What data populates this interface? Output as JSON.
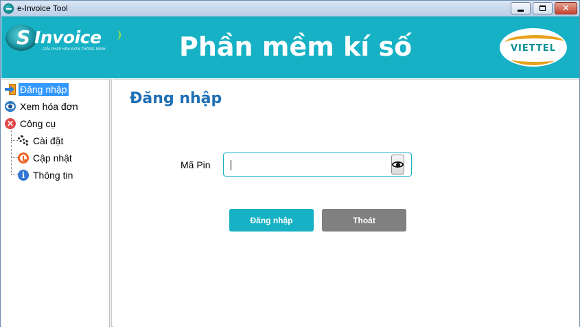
{
  "window": {
    "title": "e-Invoice Tool",
    "controls": {
      "minimize": "minimize",
      "maximize": "maximize",
      "close": "✕"
    }
  },
  "header": {
    "logo_left": {
      "brand_letter": "S",
      "brand_word": "Invoice",
      "tagline": "GIẢI PHÁP HÓA ĐƠN THÔNG MINH"
    },
    "title": "Phần mềm kí số",
    "logo_right": {
      "text": "VIETTEL"
    },
    "background_color": "#17b1c5"
  },
  "sidebar": {
    "items": [
      {
        "label": "Đăng nhập",
        "icon": "login-icon",
        "selected": true
      },
      {
        "label": "Xem hóa đơn",
        "icon": "eye-icon",
        "selected": false
      },
      {
        "label": "Công cụ",
        "icon": "tools-icon",
        "selected": false,
        "children": [
          {
            "label": "Cài đặt",
            "icon": "gears-icon"
          },
          {
            "label": "Cập nhật",
            "icon": "update-icon"
          },
          {
            "label": "Thông tin",
            "icon": "info-icon"
          }
        ]
      }
    ],
    "selected_color": "#3399ff"
  },
  "main": {
    "title": "Đăng nhập",
    "pin": {
      "label": "Mã Pin",
      "value": "",
      "toggle_icon": "eye-icon"
    },
    "buttons": {
      "login": "Đăng nhập",
      "exit": "Thoát"
    },
    "colors": {
      "primary": "#17b1c5",
      "secondary": "#808080",
      "title": "#1f6fb5"
    }
  }
}
